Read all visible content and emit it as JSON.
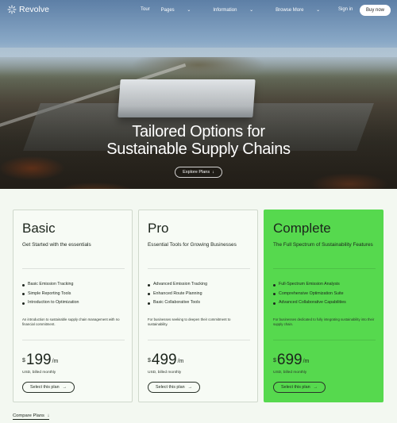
{
  "nav": {
    "brand": "Revolve",
    "links": [
      "Tour",
      "Pages",
      "Information",
      "Browse More"
    ],
    "sign_in": "Sign in",
    "buy_now": "Buy now"
  },
  "hero": {
    "title_line1": "Tailored Options for",
    "title_line2": "Sustainable Supply Chains",
    "cta": "Explore Plans"
  },
  "plans": [
    {
      "name": "Basic",
      "tagline": "Get Started with the essentials",
      "features": [
        "Basic Emission Tracking",
        "Simple Reporting Tools",
        "Introduction to Optimization"
      ],
      "description": "An introduction to sustainable supply chain management with no financial commitment.",
      "currency": "$",
      "price": "199",
      "per": "/m",
      "billed": "USD, billed monthly",
      "button": "Select this plan"
    },
    {
      "name": "Pro",
      "tagline": "Essential Tools for Growing Businesses",
      "features": [
        "Advanced Emission Tracking",
        "Enhanced Route Planning",
        "Basic Collaborative Tools"
      ],
      "description": "For businesses seeking to deepen their commitment to sustainability.",
      "currency": "$",
      "price": "499",
      "per": "/m",
      "billed": "USD, billed monthly",
      "button": "Select this plan"
    },
    {
      "name": "Complete",
      "tagline": "The Full Spectrum of Sustainability Features",
      "features": [
        "Full-Spectrum Emission Analysis",
        "Comprehensive Optimization Suite",
        "Advanced Collaborative Capabilities"
      ],
      "description": "For businesses dedicated to fully integrating sustainability into their supply chain.",
      "currency": "$",
      "price": "699",
      "per": "/m",
      "billed": "USD, billed monthly",
      "button": "Select this plan"
    }
  ],
  "compare": "Compare Plans",
  "colors": {
    "accent": "#56d94e",
    "background": "#f3f8f1"
  }
}
